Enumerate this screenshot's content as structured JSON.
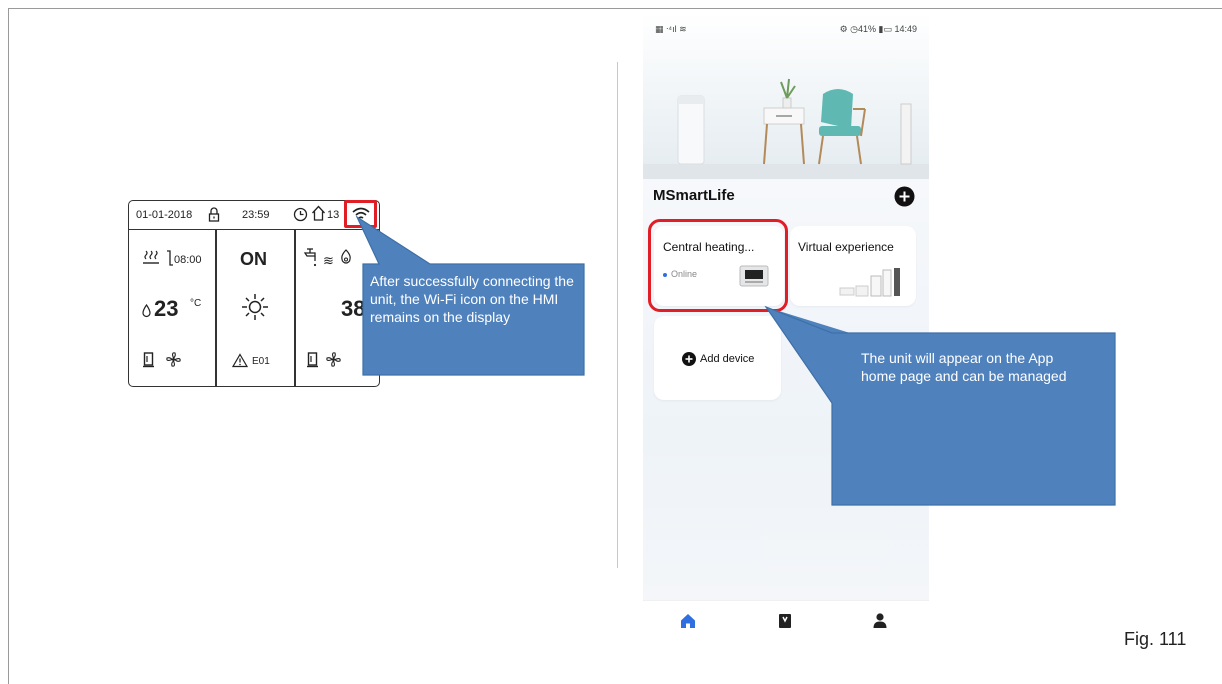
{
  "colors": {
    "callout_fill": "#4f81bd",
    "callout_border": "#3d6fa7",
    "highlight": "#e11d25",
    "accent_blue": "#2f6fe0",
    "frame": "#9a9a9a"
  },
  "hmi": {
    "date": "01-01-2018",
    "time": "23:59",
    "clock_value": "13",
    "timer": "08:00",
    "mode": "ON",
    "room_temp": "23",
    "temp_unit": "°C",
    "water_temp": "38",
    "error_code": "E01",
    "icons": [
      "lock-icon",
      "clock-icon",
      "home-icon",
      "wifi-icon",
      "heating-icon",
      "timer-icon",
      "drop-icon",
      "sun-icon",
      "tap-icon",
      "flame-icon",
      "tank-icon",
      "fan-icon",
      "warning-icon"
    ]
  },
  "callout_hmi": {
    "text": "After successfully connecting the unit, the Wi-Fi icon on the HMI remains on the display"
  },
  "phone": {
    "status": {
      "left": "▦ ᐧ⁴ıl ≋",
      "right": "⚙ ◷41% ▮▭ 14:49"
    },
    "app_title": "MSmartLife",
    "add_icon": "plus-icon",
    "cards": [
      {
        "title": "Central heating...",
        "status": "Online"
      },
      {
        "title": "Virtual experience"
      }
    ],
    "add_device_label": "Add device",
    "nav": [
      "home-icon",
      "bookmark-icon",
      "person-icon"
    ]
  },
  "callout_app": {
    "text": "The unit will appear on the App home page and can be managed"
  },
  "fig_label": "Fig. 111"
}
